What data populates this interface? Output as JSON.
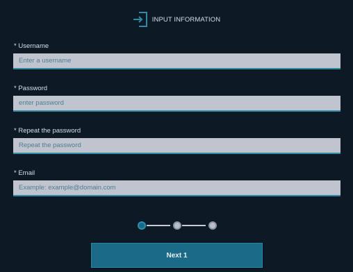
{
  "header": {
    "icon": "sign-in-icon",
    "title": "INPUT INFORMATION"
  },
  "form": {
    "fields": [
      {
        "label": "* Username",
        "placeholder": "Enter a username",
        "value": ""
      },
      {
        "label": "* Password",
        "placeholder": "enter password",
        "value": ""
      },
      {
        "label": "* Repeat the password",
        "placeholder": "Repeat the password",
        "value": ""
      },
      {
        "label": "* Email",
        "placeholder": "Example: example@domain.com",
        "value": ""
      }
    ]
  },
  "stepper": {
    "total_steps": 3,
    "current_step": 1
  },
  "actions": {
    "next_label": "Next 1"
  },
  "colors": {
    "background": "#0d1a26",
    "accent": "#1b6b88",
    "input_bg": "#bfc4cf",
    "text": "#d8dee6"
  }
}
